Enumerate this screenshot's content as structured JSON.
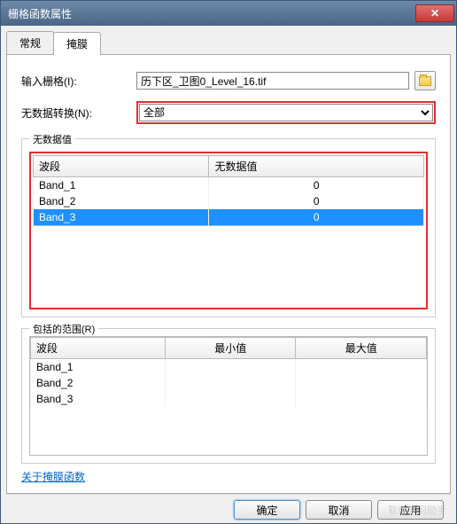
{
  "window": {
    "title": "栅格函数属性"
  },
  "tabs": {
    "general": "常规",
    "mask": "掩膜"
  },
  "form": {
    "input_raster_label": "输入栅格(I):",
    "input_raster_value": "历下区_卫图0_Level_16.tif",
    "nodata_transform_label": "无数据转换(N):",
    "nodata_transform_value": "全部"
  },
  "group_nodata": {
    "legend": "无数据值",
    "col_band": "波段",
    "col_value": "无数据值",
    "rows": [
      {
        "band": "Band_1",
        "value": "0"
      },
      {
        "band": "Band_2",
        "value": "0"
      },
      {
        "band": "Band_3",
        "value": "0"
      }
    ]
  },
  "group_extent": {
    "legend": "包括的范围(R)",
    "col_band": "波段",
    "col_min": "最小值",
    "col_max": "最大值",
    "rows": [
      {
        "band": "Band_1",
        "min": "",
        "max": ""
      },
      {
        "band": "Band_2",
        "min": "",
        "max": ""
      },
      {
        "band": "Band_3",
        "min": "",
        "max": ""
      }
    ]
  },
  "link": {
    "about": "关于掩膜函数"
  },
  "buttons": {
    "ok": "确定",
    "cancel": "取消",
    "apply": "应用"
  },
  "watermark": "软件学习助手"
}
